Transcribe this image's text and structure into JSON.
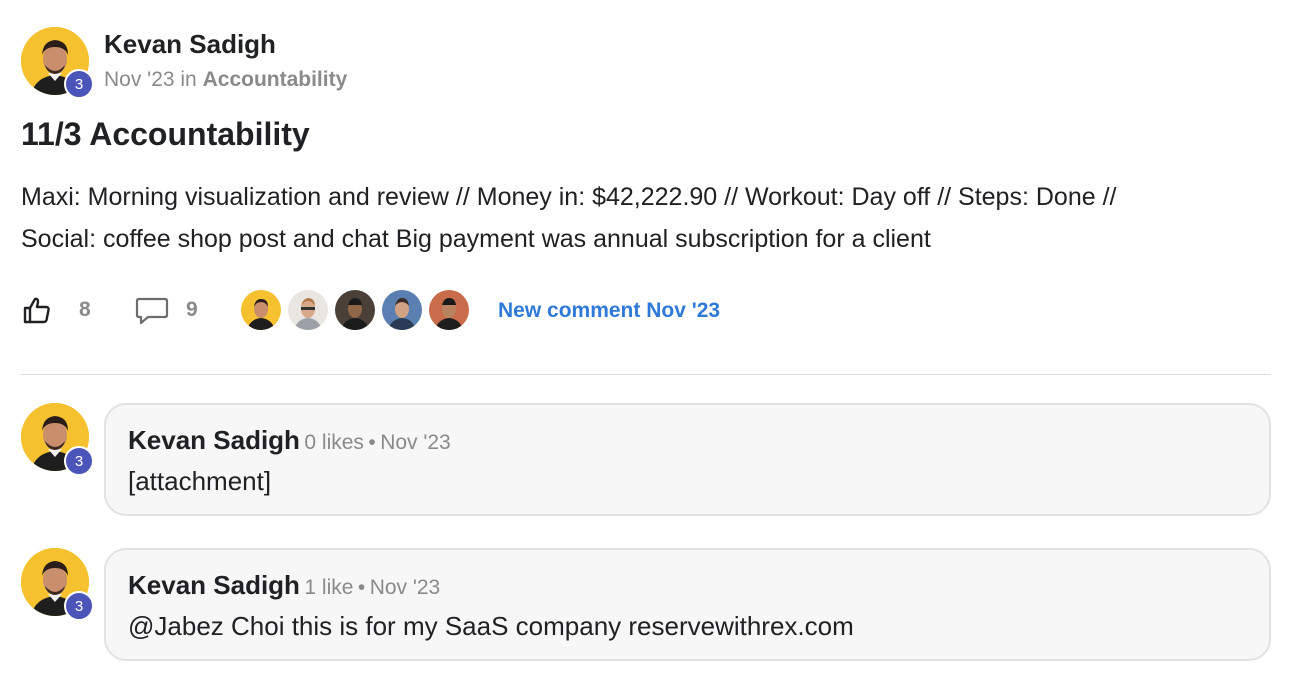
{
  "post": {
    "author": "Kevan Sadigh",
    "author_level": "3",
    "date": "Nov '23",
    "in_word": "in",
    "category": "Accountability",
    "title": "11/3 Accountability",
    "body_line1": "Maxi: Morning visualization and review // Money in: $42,222.90 // Workout: Day off // Steps: Done //",
    "body_line2": "Social: coffee shop post and chat Big payment was annual subscription for a client",
    "likes": "8",
    "comments": "9",
    "new_comment_label": "New comment Nov '23"
  },
  "comments": [
    {
      "author": "Kevan Sadigh",
      "level": "3",
      "likes": "0 likes",
      "separator": "•",
      "date": "Nov '23",
      "text": "[attachment]"
    },
    {
      "author": "Kevan Sadigh",
      "level": "3",
      "likes": "1 like",
      "separator": "•",
      "date": "Nov '23",
      "text": "@Jabez Choi this is for my SaaS company reservewithrex.com"
    }
  ],
  "icons": {
    "like": "thumbs-up-icon",
    "comment": "speech-bubble-icon"
  },
  "colors": {
    "avatar_bg": "#f5c12e",
    "level_badge": "#4b54b8",
    "link": "#2f7ad8",
    "muted": "#8a8a8a"
  }
}
